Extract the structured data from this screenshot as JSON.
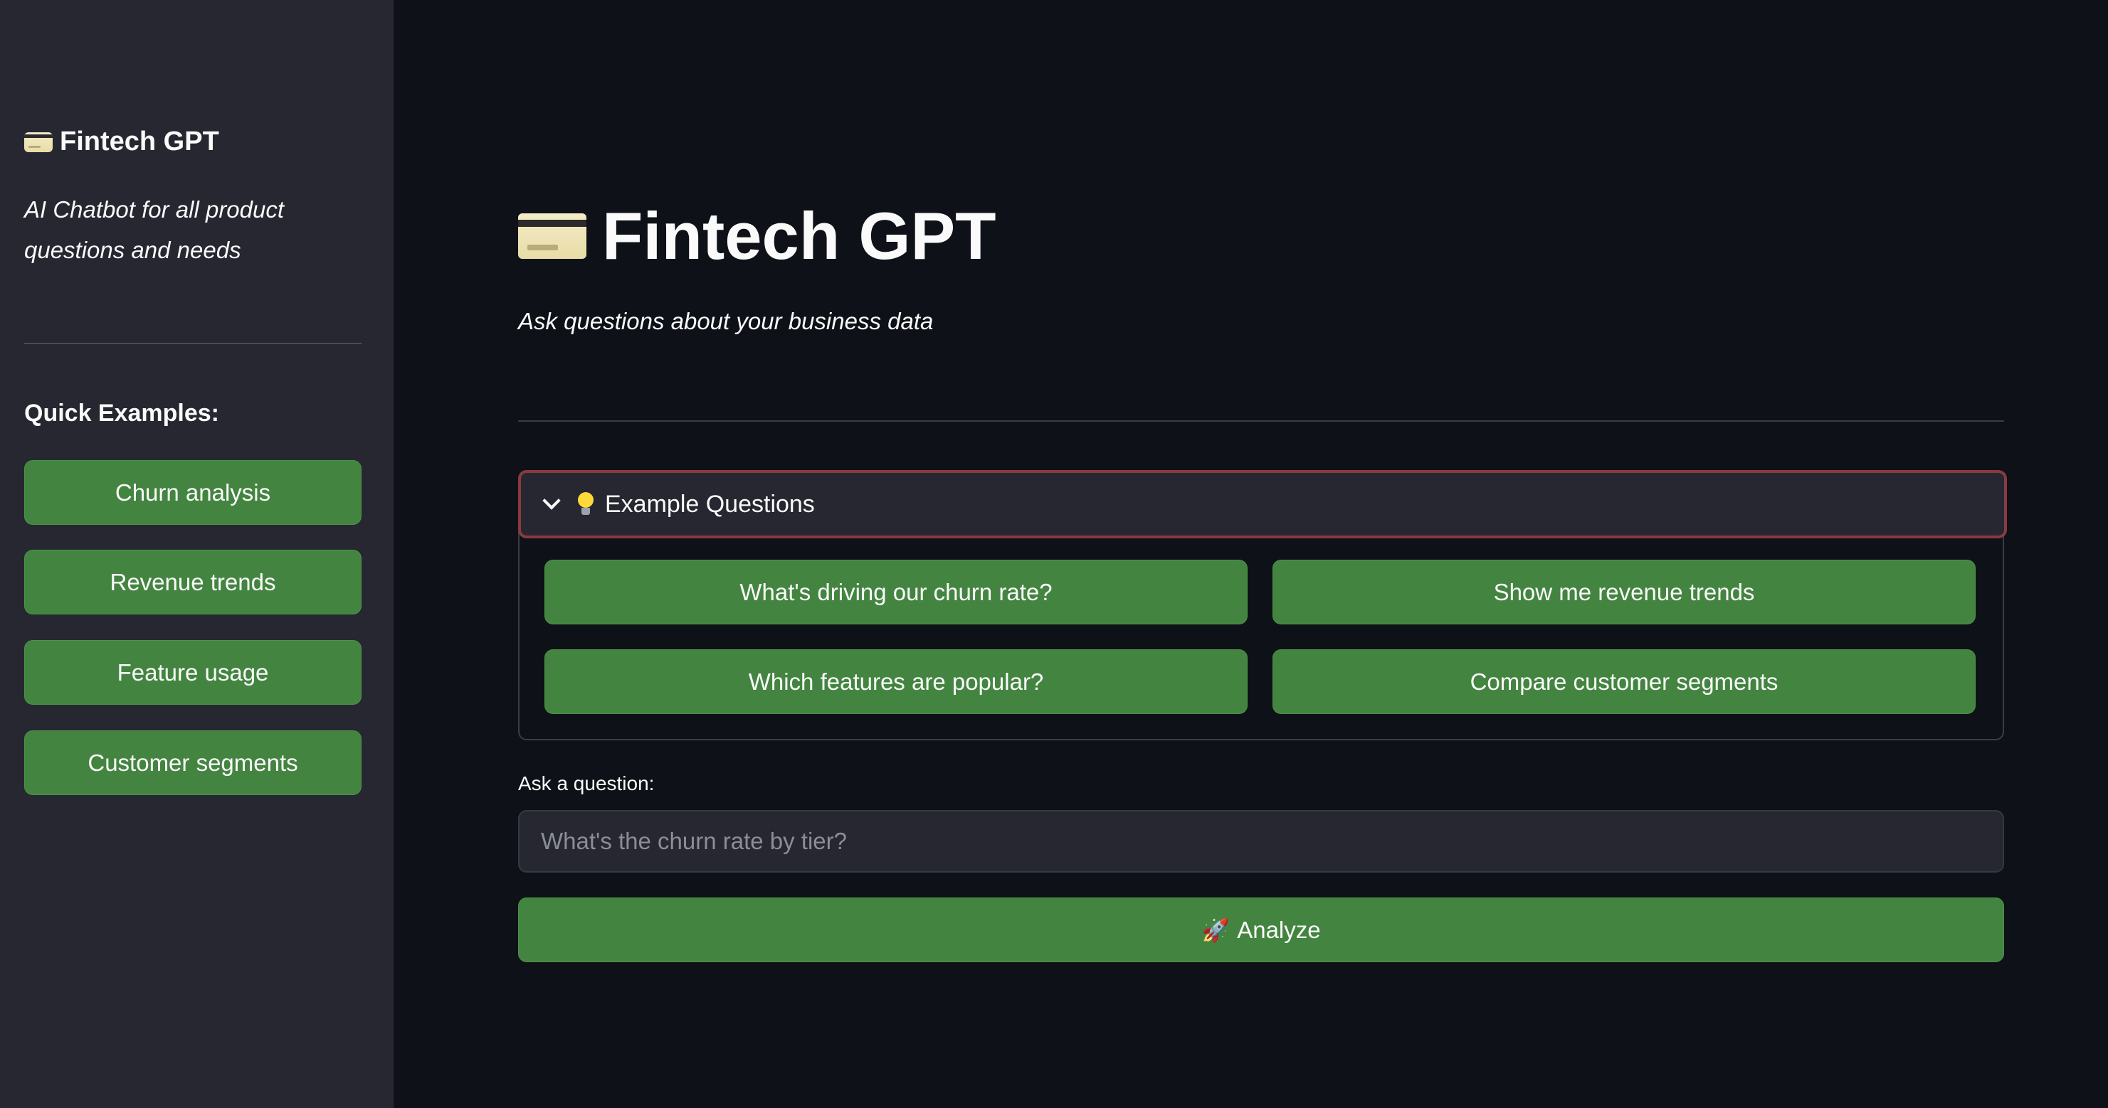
{
  "sidebar": {
    "title": "Fintech GPT",
    "title_icon": "credit-card-icon",
    "subtitle": "AI Chatbot for all product questions and needs",
    "quick_examples_label": "Quick Examples:",
    "buttons": [
      "Churn analysis",
      "Revenue trends",
      "Feature usage",
      "Customer segments"
    ]
  },
  "main": {
    "title": "Fintech GPT",
    "title_icon": "credit-card-icon",
    "subtitle": "Ask questions about your business data",
    "expander": {
      "label": "Example Questions",
      "icon": "lightbulb-icon",
      "expanded": true,
      "buttons": [
        "What's driving our churn rate?",
        "Show me revenue trends",
        "Which features are popular?",
        "Compare customer segments"
      ]
    },
    "ask": {
      "label": "Ask a question:",
      "placeholder": "What's the churn rate by tier?",
      "value": ""
    },
    "analyze_button": {
      "label": "Analyze",
      "icon": "rocket-icon"
    }
  },
  "colors": {
    "background": "#0e1117",
    "sidebar": "#262730",
    "button": "#438540",
    "focus_border": "#8a3a3f"
  }
}
